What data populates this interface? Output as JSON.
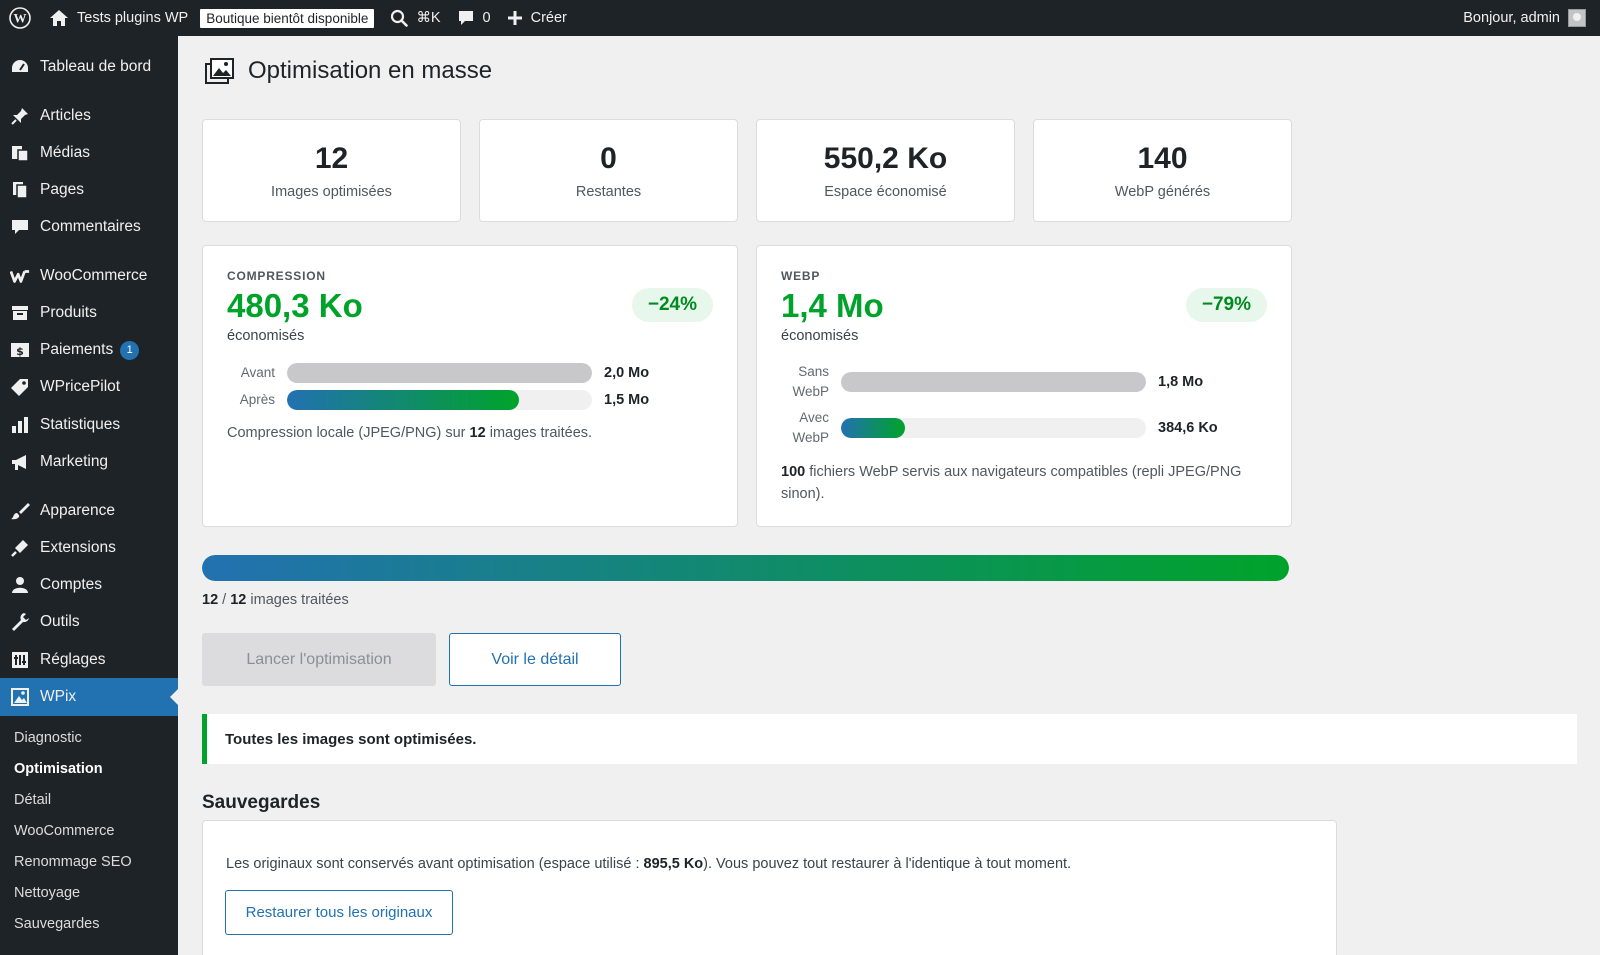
{
  "adminbar": {
    "site_name": "Tests plugins WP",
    "shop_badge": "Boutique bientôt disponible",
    "search_shortcut": "⌘K",
    "comments_count": "0",
    "create_label": "Créer",
    "greeting": "Bonjour, admin"
  },
  "sidebar": {
    "items": [
      {
        "label": "Tableau de bord"
      },
      {
        "label": "Articles"
      },
      {
        "label": "Médias"
      },
      {
        "label": "Pages"
      },
      {
        "label": "Commentaires"
      },
      {
        "label": "WooCommerce"
      },
      {
        "label": "Produits"
      },
      {
        "label": "Paiements",
        "badge": "1"
      },
      {
        "label": "WPricePilot"
      },
      {
        "label": "Statistiques"
      },
      {
        "label": "Marketing"
      },
      {
        "label": "Apparence"
      },
      {
        "label": "Extensions"
      },
      {
        "label": "Comptes"
      },
      {
        "label": "Outils"
      },
      {
        "label": "Réglages"
      },
      {
        "label": "WPix"
      }
    ],
    "submenu": [
      {
        "label": "Diagnostic"
      },
      {
        "label": "Optimisation"
      },
      {
        "label": "Détail"
      },
      {
        "label": "WooCommerce"
      },
      {
        "label": "Renommage SEO"
      },
      {
        "label": "Nettoyage"
      },
      {
        "label": "Sauvegardes"
      }
    ]
  },
  "page": {
    "title": "Optimisation en masse"
  },
  "stats": [
    {
      "value": "12",
      "label": "Images optimisées"
    },
    {
      "value": "0",
      "label": "Restantes"
    },
    {
      "value": "550,2 Ko",
      "label": "Espace économisé"
    },
    {
      "value": "140",
      "label": "WebP générés"
    }
  ],
  "compression": {
    "heading": "COMPRESSION",
    "amount": "480,3 Ko",
    "saved_label": "économisés",
    "percent": "−24%",
    "before_label": "Avant",
    "before_value": "2,0 Mo",
    "before_fraction": 1.0,
    "after_label": "Après",
    "after_value": "1,5 Mo",
    "after_fraction": 0.76,
    "note_prefix": "Compression locale (JPEG/PNG) sur",
    "note_count": "12",
    "note_suffix": "images traitées."
  },
  "webp": {
    "heading": "WEBP",
    "amount": "1,4 Mo",
    "saved_label": "économisés",
    "percent": "−79%",
    "without_label_1": "Sans",
    "without_label_2": "WebP",
    "without_value": "1,8 Mo",
    "without_fraction": 1.0,
    "with_label_1": "Avec",
    "with_label_2": "WebP",
    "with_value": "384,6 Ko",
    "with_fraction": 0.21,
    "note_count": "100",
    "note_line1": "fichiers WebP servis aux navigateurs compatibles (repli JPEG/PNG",
    "note_line2": "sinon)."
  },
  "progress": {
    "done": "12",
    "separator": "/",
    "total": "12",
    "label": "images traitées",
    "fraction": 1.0
  },
  "buttons": {
    "start": "Lancer l'optimisation",
    "details": "Voir le détail",
    "restore": "Restaurer tous les originaux"
  },
  "notice": {
    "text": "Toutes les images sont optimisées."
  },
  "backups": {
    "title": "Sauvegardes",
    "text_prefix": "Les originaux sont conservés avant optimisation (espace utilisé :",
    "space": "895,5 Ko",
    "text_suffix": "). Vous pouvez tout restaurer à l'identique à tout moment."
  },
  "colors": {
    "accent": "#2271b1",
    "success": "#00a32a",
    "adminbar": "#1d2327"
  }
}
